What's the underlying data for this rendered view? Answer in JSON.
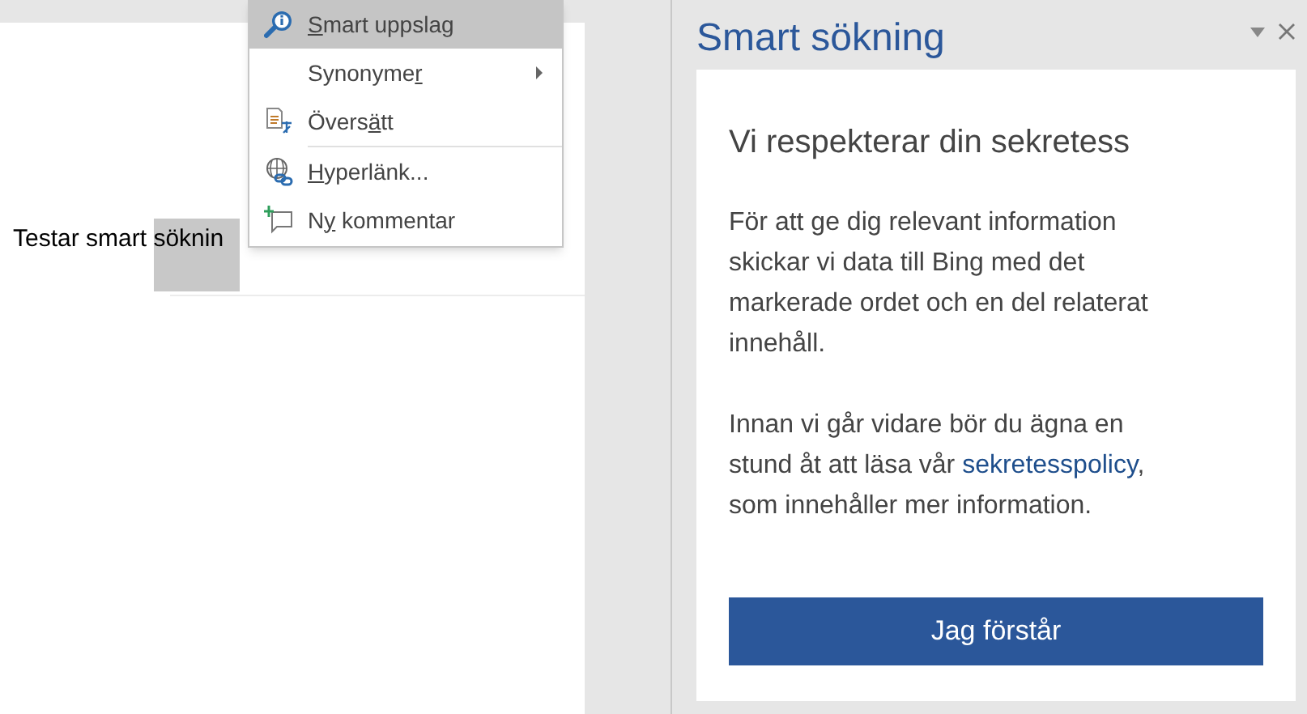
{
  "document": {
    "text": "Testar smart ",
    "selection": "söknin"
  },
  "context_menu": {
    "items": [
      {
        "kind": "lookup",
        "label": {
          "key": "S",
          "after": "mart uppslag"
        },
        "selected": true,
        "submenu": false,
        "separator_after": false
      },
      {
        "kind": "none",
        "label": {
          "before": "Synonyme",
          "key": "r"
        },
        "selected": false,
        "submenu": true,
        "separator_after": false
      },
      {
        "kind": "translate",
        "label": {
          "before": "Övers",
          "key": "ä",
          "after": "tt"
        },
        "selected": false,
        "submenu": false,
        "separator_after": true
      },
      {
        "kind": "link",
        "label": {
          "key": "H",
          "after": "yperlänk..."
        },
        "selected": false,
        "submenu": false,
        "separator_after": false
      },
      {
        "kind": "comment",
        "label": {
          "before": "N",
          "key": "y",
          "after": " kommentar"
        },
        "selected": false,
        "submenu": false,
        "separator_after": false
      }
    ]
  },
  "pane": {
    "title": "Smart sökning",
    "card": {
      "heading": "Vi respekterar din sekretess",
      "paragraph_1": "För att ge dig relevant information skickar vi data till Bing med det markerade ordet och en del relaterat innehåll.",
      "paragraph_2_before": "Innan vi går vidare bör du ägna en stund åt att läsa vår ",
      "paragraph_2_link": "sekretesspolicy",
      "paragraph_2_after": ", som innehåller mer information.",
      "button": "Jag förstår"
    }
  }
}
